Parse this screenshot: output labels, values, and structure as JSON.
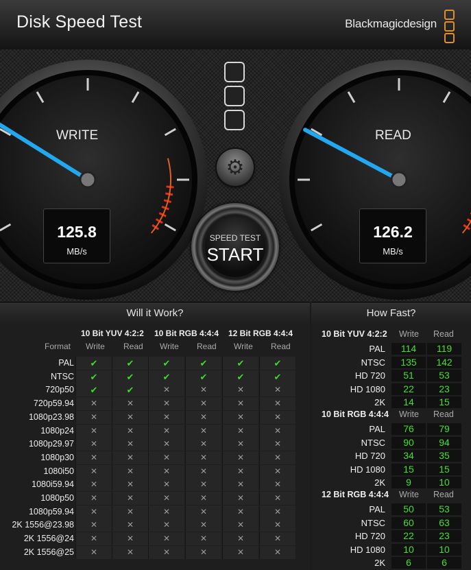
{
  "app": {
    "title": "Disk Speed Test",
    "brand": "Blackmagicdesign"
  },
  "gauges": {
    "write": {
      "label": "WRITE",
      "value": "125.8",
      "unit": "MB/s"
    },
    "read": {
      "label": "READ",
      "value": "126.2",
      "unit": "MB/s"
    }
  },
  "controls": {
    "settings_icon": "gear-icon",
    "start_small": "SPEED TEST",
    "start_big": "START"
  },
  "will_it_work": {
    "heading": "Will it Work?",
    "format_header": "Format",
    "column_groups": [
      "10 Bit YUV 4:2:2",
      "10 Bit RGB 4:4:4",
      "12 Bit RGB 4:4:4"
    ],
    "sub_headers": [
      "Write",
      "Read",
      "Write",
      "Read",
      "Write",
      "Read"
    ],
    "rows": [
      {
        "format": "PAL",
        "marks": [
          1,
          1,
          1,
          1,
          1,
          1
        ]
      },
      {
        "format": "NTSC",
        "marks": [
          1,
          1,
          1,
          1,
          1,
          1
        ]
      },
      {
        "format": "720p50",
        "marks": [
          1,
          1,
          0,
          0,
          0,
          0
        ]
      },
      {
        "format": "720p59.94",
        "marks": [
          0,
          0,
          0,
          0,
          0,
          0
        ]
      },
      {
        "format": "1080p23.98",
        "marks": [
          0,
          0,
          0,
          0,
          0,
          0
        ]
      },
      {
        "format": "1080p24",
        "marks": [
          0,
          0,
          0,
          0,
          0,
          0
        ]
      },
      {
        "format": "1080p29.97",
        "marks": [
          0,
          0,
          0,
          0,
          0,
          0
        ]
      },
      {
        "format": "1080p30",
        "marks": [
          0,
          0,
          0,
          0,
          0,
          0
        ]
      },
      {
        "format": "1080i50",
        "marks": [
          0,
          0,
          0,
          0,
          0,
          0
        ]
      },
      {
        "format": "1080i59.94",
        "marks": [
          0,
          0,
          0,
          0,
          0,
          0
        ]
      },
      {
        "format": "1080p50",
        "marks": [
          0,
          0,
          0,
          0,
          0,
          0
        ]
      },
      {
        "format": "1080p59.94",
        "marks": [
          0,
          0,
          0,
          0,
          0,
          0
        ]
      },
      {
        "format": "2K 1556@23.98",
        "marks": [
          0,
          0,
          0,
          0,
          0,
          0
        ]
      },
      {
        "format": "2K 1556@24",
        "marks": [
          0,
          0,
          0,
          0,
          0,
          0
        ]
      },
      {
        "format": "2K 1556@25",
        "marks": [
          0,
          0,
          0,
          0,
          0,
          0
        ]
      }
    ]
  },
  "how_fast": {
    "heading": "How Fast?",
    "groups": [
      {
        "title": "10 Bit YUV 4:2:2",
        "write_label": "Write",
        "read_label": "Read",
        "rows": [
          {
            "label": "PAL",
            "write": "114",
            "read": "119"
          },
          {
            "label": "NTSC",
            "write": "135",
            "read": "142"
          },
          {
            "label": "HD 720",
            "write": "51",
            "read": "53"
          },
          {
            "label": "HD 1080",
            "write": "22",
            "read": "23"
          },
          {
            "label": "2K",
            "write": "14",
            "read": "15"
          }
        ]
      },
      {
        "title": "10 Bit RGB 4:4:4",
        "write_label": "Write",
        "read_label": "Read",
        "rows": [
          {
            "label": "PAL",
            "write": "76",
            "read": "79"
          },
          {
            "label": "NTSC",
            "write": "90",
            "read": "94"
          },
          {
            "label": "HD 720",
            "write": "34",
            "read": "35"
          },
          {
            "label": "HD 1080",
            "write": "15",
            "read": "15"
          },
          {
            "label": "2K",
            "write": "9",
            "read": "10"
          }
        ]
      },
      {
        "title": "12 Bit RGB 4:4:4",
        "write_label": "Write",
        "read_label": "Read",
        "rows": [
          {
            "label": "PAL",
            "write": "50",
            "read": "53"
          },
          {
            "label": "NTSC",
            "write": "60",
            "read": "63"
          },
          {
            "label": "HD 720",
            "write": "22",
            "read": "23"
          },
          {
            "label": "HD 1080",
            "write": "10",
            "read": "10"
          },
          {
            "label": "2K",
            "write": "6",
            "read": "6"
          }
        ]
      }
    ]
  },
  "colors": {
    "needle": "#21a8f0",
    "ok": "#3cdc2a",
    "value_green": "#45e02c",
    "redline": "#e0301a",
    "logo_orange": "#e0902a"
  }
}
